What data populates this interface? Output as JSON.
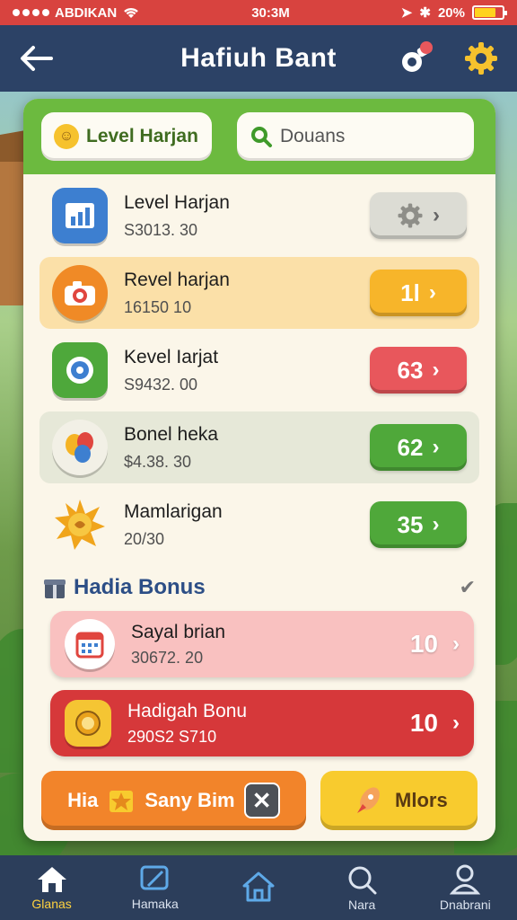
{
  "status_bar": {
    "carrier": "ABDIKAN",
    "time": "30:3M",
    "battery": "20%",
    "battery_level": 0.75
  },
  "header": {
    "title": "Hafiuh Bant"
  },
  "tabs": {
    "level": "Level Harjan",
    "search_placeholder": "Douans"
  },
  "items": [
    {
      "title": "Level Harjan",
      "sub": "S3013. 30",
      "action": "",
      "color": "#dcdcd4"
    },
    {
      "title": "Revel harjan",
      "sub": "16150  10",
      "action": "1l",
      "color": "#f7b52a"
    },
    {
      "title": "Kevel Iarjat",
      "sub": "S9432. 00",
      "action": "63",
      "color": "#e8575c"
    },
    {
      "title": "Bonel heka",
      "sub": "$4.38. 30",
      "action": "62",
      "color": "#4fa83a"
    },
    {
      "title": "Mamlarigan",
      "sub": "20/30",
      "action": "35",
      "color": "#4fa83a"
    }
  ],
  "section": {
    "title": "Hadia Bonus"
  },
  "bonus": [
    {
      "title": "Sayal brian",
      "sub": "30672. 20",
      "value": "10"
    },
    {
      "title": "Hadigah Bonu",
      "sub": "290S2 S710",
      "value": "10"
    }
  ],
  "actions": {
    "primary": "Hia",
    "primary_extra": "Sany Bim",
    "secondary": "Mlors"
  },
  "nav": [
    {
      "label": "Glanas"
    },
    {
      "label": "Hamaka"
    },
    {
      "label": ""
    },
    {
      "label": "Nara"
    },
    {
      "label": "Dnabrani"
    }
  ]
}
